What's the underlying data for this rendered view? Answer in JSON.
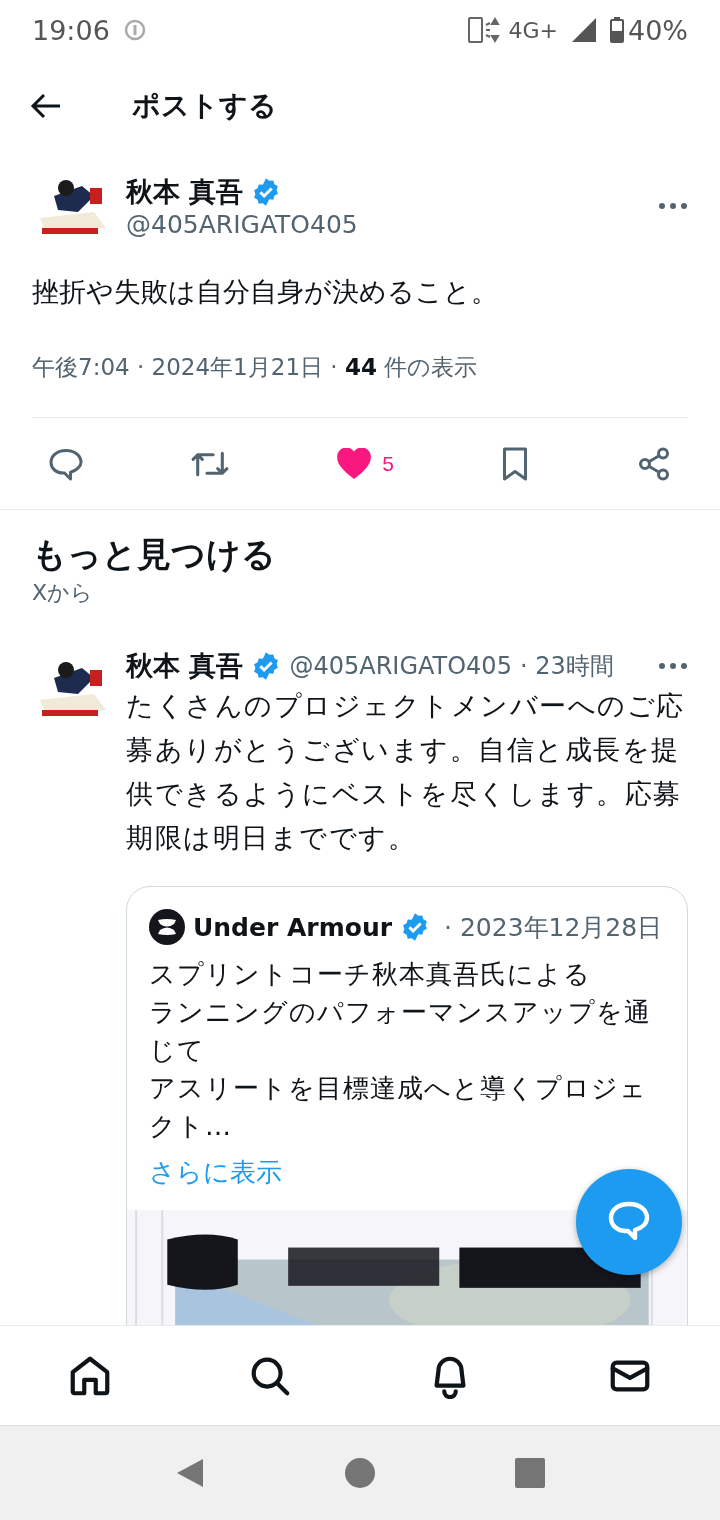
{
  "status_bar": {
    "time": "19:06",
    "network": "4G+",
    "battery": "40%"
  },
  "header": {
    "title": "ポストする"
  },
  "post": {
    "author": {
      "name": "秋本 真吾",
      "handle": "@405ARIGATO405",
      "verified": true
    },
    "text": "挫折や失敗は自分自身が決めること。",
    "meta": "午後7:04 · 2024年1月21日 · **44** 件の表示",
    "liked": true,
    "like_count": "5"
  },
  "discover": {
    "title": "もっと見つける",
    "subtitle": "Xから"
  },
  "feed": [
    {
      "author": {
        "name": "秋本 真吾",
        "handle": "@405ARIGATO405",
        "verified": true
      },
      "time": "· 23時間",
      "text": "たくさんのプロジェクトメンバーへのご応募ありがとうございます。自信と成長を提供できるようにベストを尽くします。応募期限は明日までです。",
      "quote": {
        "name": "Under Armour",
        "verified": true,
        "date": "· 2023年12月28日",
        "text": [
          "スプリントコーチ秋本真吾氏による",
          "ランニングのパフォーマンスアップを通じて",
          "アスリートを目標達成へと導くプロジェクト…"
        ],
        "more": "さらに表示"
      }
    }
  ]
}
